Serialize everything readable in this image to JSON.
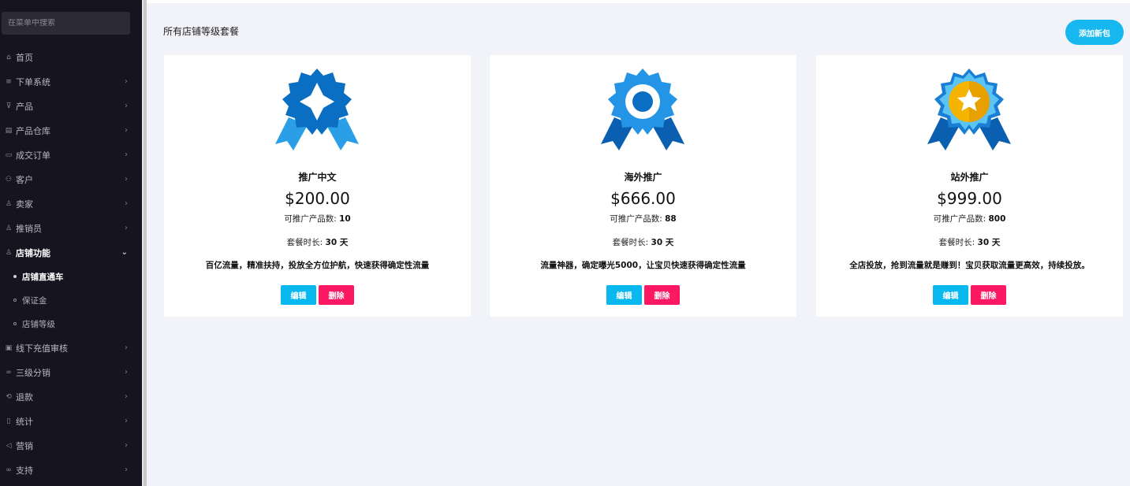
{
  "sidebar": {
    "search_placeholder": "在菜单中搜索",
    "items": [
      {
        "label": "首页",
        "icon": "home-icon",
        "glyph": "⌂",
        "chevron": false
      },
      {
        "label": "下单系统",
        "icon": "list-icon",
        "glyph": "≡",
        "chevron": true
      },
      {
        "label": "产品",
        "icon": "cart-icon",
        "glyph": "⊽",
        "chevron": true
      },
      {
        "label": "产品仓库",
        "icon": "warehouse-icon",
        "glyph": "▤",
        "chevron": true
      },
      {
        "label": "成交订单",
        "icon": "ticket-icon",
        "glyph": "▭",
        "chevron": true
      },
      {
        "label": "客户",
        "icon": "users-icon",
        "glyph": "⚇",
        "chevron": true
      },
      {
        "label": "卖家",
        "icon": "user-icon",
        "glyph": "♙",
        "chevron": true
      },
      {
        "label": "推销员",
        "icon": "user-icon",
        "glyph": "♙",
        "chevron": true
      },
      {
        "label": "店铺功能",
        "icon": "user-icon",
        "glyph": "♙",
        "chevron": true,
        "expanded": true
      }
    ],
    "subitems": [
      {
        "label": "店铺直通车",
        "active": true
      },
      {
        "label": "保证金",
        "active": false
      },
      {
        "label": "店铺等级",
        "active": false
      }
    ],
    "items_after": [
      {
        "label": "线下充值审核",
        "icon": "money-icon",
        "glyph": "▣",
        "chevron": true
      },
      {
        "label": "三级分销",
        "icon": "link-icon",
        "glyph": "∞",
        "chevron": true
      },
      {
        "label": "退款",
        "icon": "refund-icon",
        "glyph": "⟲",
        "chevron": true
      },
      {
        "label": "统计",
        "icon": "document-icon",
        "glyph": "▯",
        "chevron": true
      },
      {
        "label": "营销",
        "icon": "megaphone-icon",
        "glyph": "◁",
        "chevron": true
      },
      {
        "label": "支持",
        "icon": "link-icon",
        "glyph": "∞",
        "chevron": true
      }
    ]
  },
  "main": {
    "title": "所有店铺等级套餐",
    "add_button": "添加新包"
  },
  "cards": [
    {
      "title": "推广中文",
      "price": "$200.00",
      "products_label": "可推广产品数:",
      "products": "10",
      "duration_label": "套餐时长:",
      "duration": "30 天",
      "desc": "百亿流量，精准扶持，投放全方位护航，快速获得确定性流量",
      "edit": "编辑",
      "delete": "删除",
      "badge": "blue-diamond-badge-icon"
    },
    {
      "title": "海外推广",
      "price": "$666.00",
      "products_label": "可推广产品数:",
      "products": "88",
      "duration_label": "套餐时长:",
      "duration": "30 天",
      "desc": "流量神器，确定曝光5000，让宝贝快速获得确定性流量",
      "edit": "编辑",
      "delete": "删除",
      "badge": "blue-circle-badge-icon"
    },
    {
      "title": "站外推广",
      "price": "$999.00",
      "products_label": "可推广产品数:",
      "products": "800",
      "duration_label": "套餐时长:",
      "duration": "30 天",
      "desc": "全店投放，抢到流量就是赚到！宝贝获取流量更高效，持续投放。",
      "edit": "编辑",
      "delete": "删除",
      "badge": "gold-star-badge-icon"
    }
  ],
  "colors": {
    "sidebar_bg": "#15141f",
    "accent_cyan": "#17b8ef",
    "delete_pink": "#fc1862",
    "badge_blue": "#0a6fc2",
    "badge_light_blue": "#2394e6",
    "badge_gold": "#f5b400"
  }
}
